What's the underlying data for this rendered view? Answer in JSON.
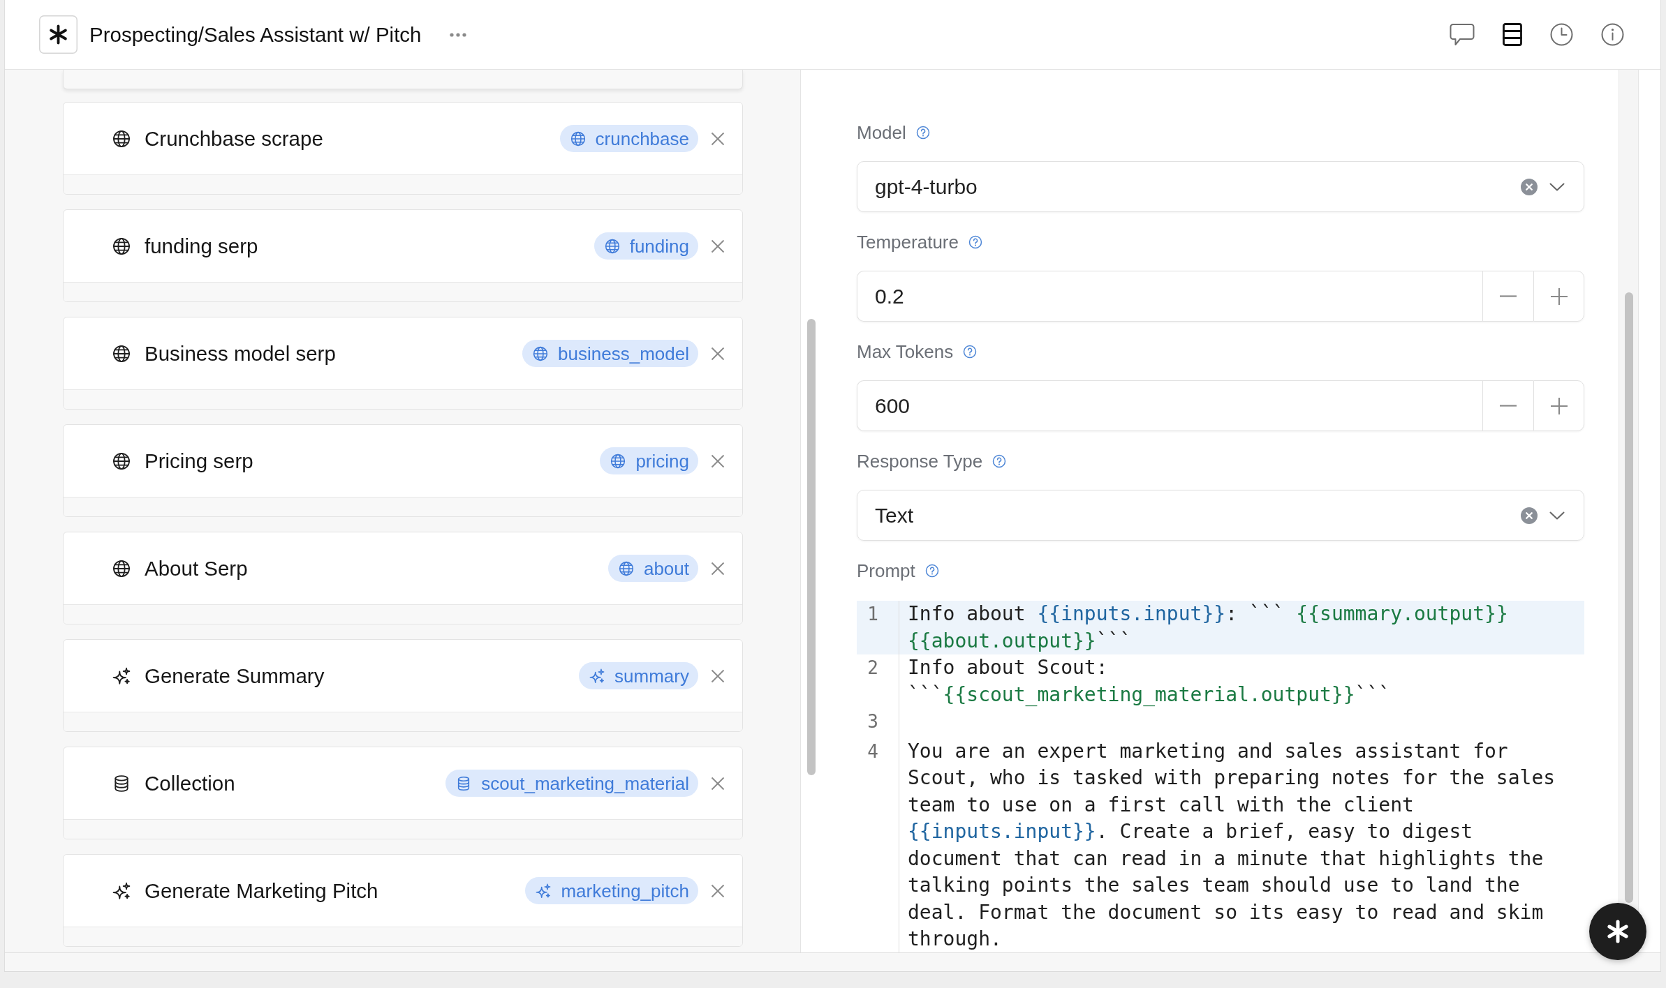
{
  "header": {
    "title": "Prospecting/Sales Assistant w/ Pitch",
    "toolbar": [
      {
        "kind": "chat",
        "selected": false
      },
      {
        "kind": "layout",
        "selected": true
      },
      {
        "kind": "history",
        "selected": false
      },
      {
        "kind": "info",
        "selected": false
      }
    ]
  },
  "nodes": [
    {
      "kind": "web",
      "label": "Crunchbase scrape",
      "tag": "crunchbase"
    },
    {
      "kind": "web",
      "label": "funding serp",
      "tag": "funding"
    },
    {
      "kind": "web",
      "label": "Business model serp",
      "tag": "business_model"
    },
    {
      "kind": "web",
      "label": "Pricing serp",
      "tag": "pricing"
    },
    {
      "kind": "web",
      "label": "About Serp",
      "tag": "about"
    },
    {
      "kind": "llm",
      "label": "Generate Summary",
      "tag": "summary"
    },
    {
      "kind": "collection",
      "label": "Collection",
      "tag": "scout_marketing_material"
    },
    {
      "kind": "llm",
      "label": "Generate Marketing Pitch",
      "tag": "marketing_pitch"
    }
  ],
  "settings": {
    "fields": [
      {
        "kind": "select",
        "label": "Model",
        "value": "gpt-4-turbo"
      },
      {
        "kind": "number",
        "label": "Temperature",
        "value": "0.2"
      },
      {
        "kind": "number",
        "label": "Max Tokens",
        "value": "600"
      },
      {
        "kind": "select",
        "label": "Response Type",
        "value": "Text"
      }
    ],
    "prompt": {
      "label": "Prompt",
      "lines": [
        {
          "number": "1",
          "selected": true,
          "segments": [
            {
              "kind": "text",
              "text": "Info about "
            },
            {
              "kind": "input",
              "text": "{{inputs.input}}"
            },
            {
              "kind": "text",
              "text": ": ``` "
            },
            {
              "kind": "output",
              "text": "{{summary.output}} {{about.output}}"
            },
            {
              "kind": "text",
              "text": "```"
            }
          ]
        },
        {
          "number": "2",
          "selected": false,
          "segments": [
            {
              "kind": "text",
              "text": "Info about Scout: ```"
            },
            {
              "kind": "output",
              "text": "{{scout_marketing_material.output}}"
            },
            {
              "kind": "text",
              "text": "```"
            }
          ]
        },
        {
          "number": "3",
          "selected": false
        },
        {
          "number": "4",
          "selected": false,
          "segments": [
            {
              "kind": "text",
              "text": "You are an expert marketing and sales assistant for Scout, who is tasked with preparing notes for the sales team to use on a first call with the client "
            },
            {
              "kind": "input",
              "text": "{{inputs.input}}"
            },
            {
              "kind": "text",
              "text": ". Create a brief, easy to digest document that can read in a minute that highlights the talking points the sales team should use to land the deal. Format the document so its easy to read and skim through."
            }
          ]
        }
      ]
    }
  }
}
